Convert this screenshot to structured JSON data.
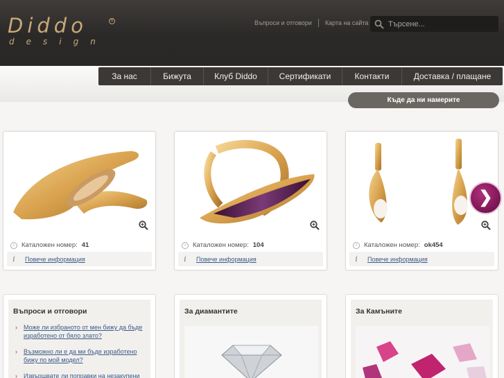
{
  "logo": {
    "word": "Diddo",
    "sub": "design",
    "reg": "R"
  },
  "toplinks": {
    "faq": "Въпроси и отговори",
    "sitemap": "Карта на сайта"
  },
  "search": {
    "placeholder": "Търсене..."
  },
  "nav": [
    {
      "label": "За нас"
    },
    {
      "label": "Бижута"
    },
    {
      "label": "Клуб Diddo"
    },
    {
      "label": "Сертификати"
    },
    {
      "label": "Контакти"
    },
    {
      "label": "Доставка / плащане"
    }
  ],
  "find_button": "Къде да ни намерите",
  "products": [
    {
      "cat_label": "Каталожен номер:",
      "cat_value": "41",
      "more": "Повече информация",
      "stone": "#c9a070"
    },
    {
      "cat_label": "Каталожен номер:",
      "cat_value": "104",
      "more": "Повече информация",
      "stone": "#5a1f4a"
    },
    {
      "cat_label": "Каталожен номер:",
      "cat_value": "ok454",
      "more": "Повече информация",
      "stone": "#f4f0ea"
    }
  ],
  "next_arrow": "❯",
  "faq": {
    "title": "Въпроси и отговори",
    "items": [
      "Може ли избраното от мен бижу да бъде изработено от бяло злато?",
      "Възможно ли е да ми бъде изработено бижу по мой модел?",
      "Извършвате ли поправки на незакупени от"
    ]
  },
  "diamonds": {
    "title": "За диамантите"
  },
  "stones": {
    "title": "За Камъните"
  },
  "colors": {
    "gold": "#d9ab5c",
    "accent": "#b3266f",
    "header": "#2b2927"
  }
}
